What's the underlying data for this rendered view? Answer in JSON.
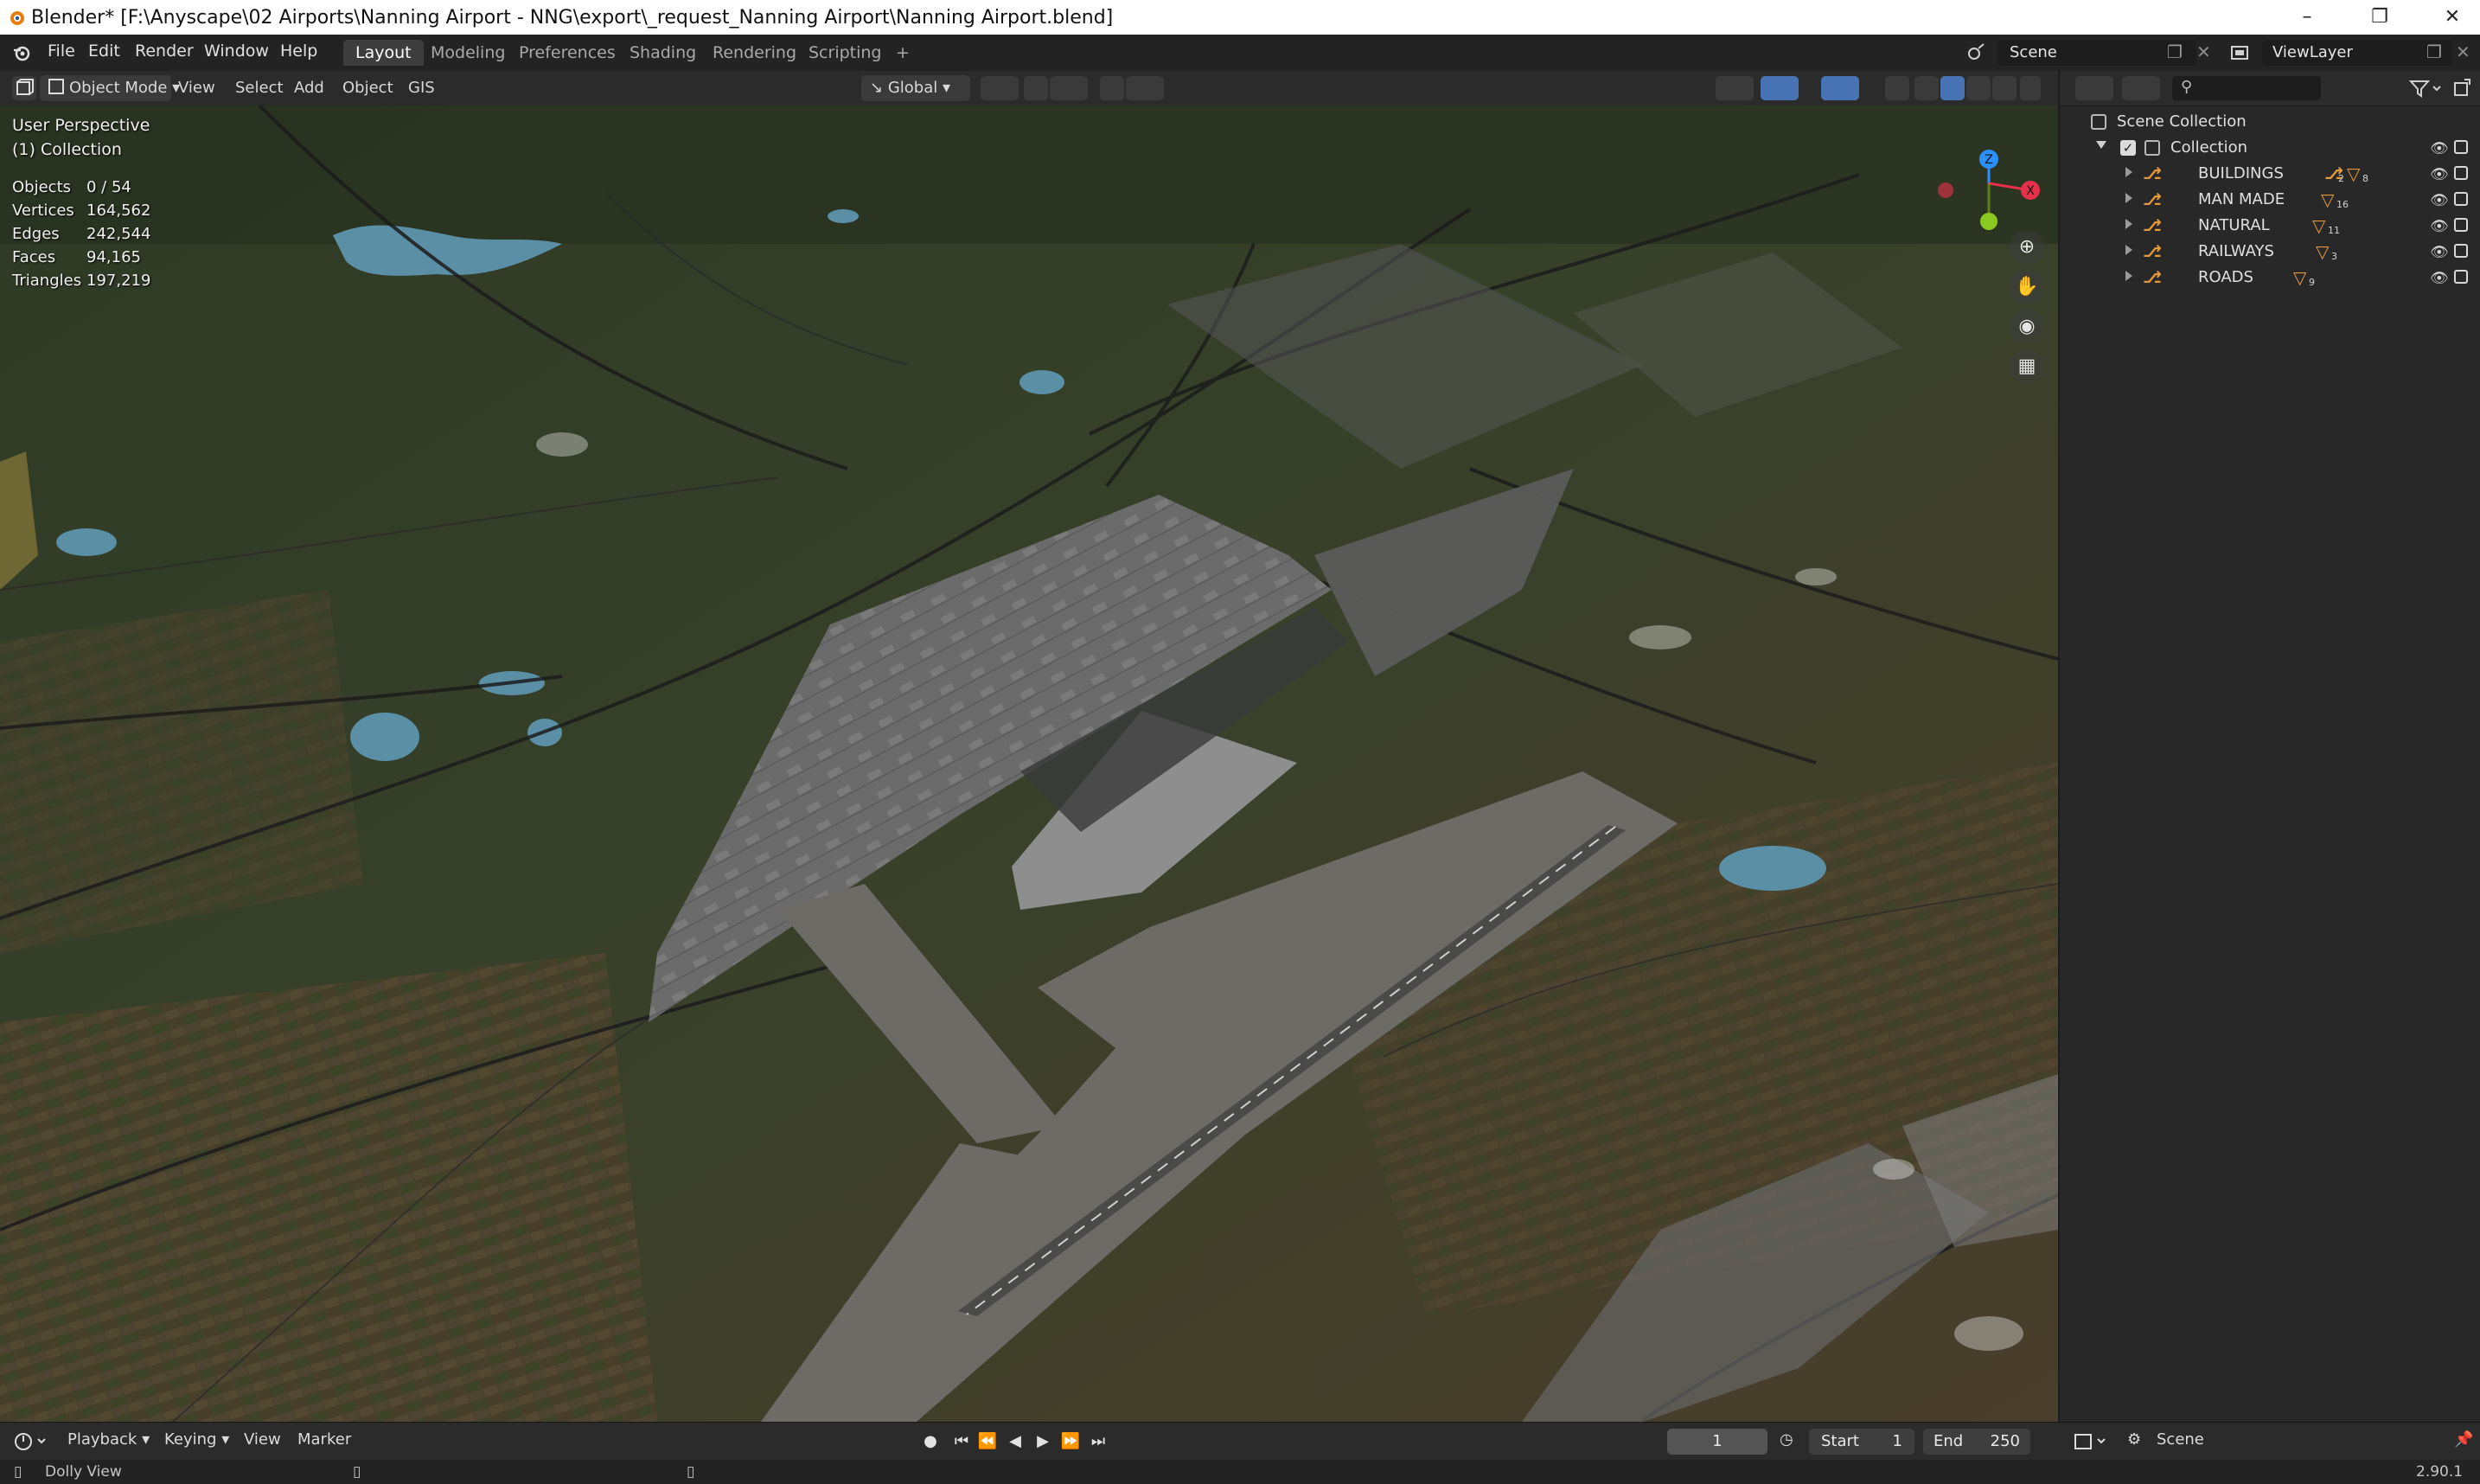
{
  "window": {
    "title": "Blender* [F:\\Anyscape\\02    Airports\\Nanning Airport - NNG\\export\\_request_Nanning Airport\\Nanning Airport.blend]",
    "controls": [
      "minimize",
      "maximize",
      "close"
    ]
  },
  "menu": {
    "items": [
      "File",
      "Edit",
      "Render",
      "Window",
      "Help"
    ],
    "workspaces": [
      "Layout",
      "Modeling",
      "Preferences",
      "Shading",
      "Rendering",
      "Scripting"
    ],
    "active_workspace": "Layout",
    "add_workspace": "+",
    "scene_label": "Scene",
    "view_layer_label": "ViewLayer"
  },
  "viewport_header": {
    "mode": "Object Mode",
    "menus": [
      "View",
      "Select",
      "Add",
      "Object",
      "GIS"
    ],
    "transform_orientation": "Global"
  },
  "viewport": {
    "perspective": "User Perspective",
    "collection": "(1) Collection",
    "stats": [
      {
        "label": "Objects",
        "value": "0 / 54"
      },
      {
        "label": "Vertices",
        "value": "164,562"
      },
      {
        "label": "Edges",
        "value": "242,544"
      },
      {
        "label": "Faces",
        "value": "94,165"
      },
      {
        "label": "Triangles",
        "value": "197,219"
      }
    ],
    "gizmo_axes": {
      "z": "Z",
      "x": "X"
    },
    "colors": {
      "x_axis": "#e7304c",
      "y_axis": "#8ac920",
      "z_axis": "#2c8fff"
    }
  },
  "outliner": {
    "root": "Scene Collection",
    "collection": "Collection",
    "items": [
      {
        "label": "BUILDINGS",
        "sub_empty_count": "2",
        "sub_mesh_count": "8"
      },
      {
        "label": "MAN MADE",
        "sub_mesh_count": "16"
      },
      {
        "label": "NATURAL",
        "sub_mesh_count": "11"
      },
      {
        "label": "RAILWAYS",
        "sub_mesh_count": "3"
      },
      {
        "label": "ROADS",
        "sub_mesh_count": "9"
      }
    ]
  },
  "timeline": {
    "menus": [
      "Playback",
      "Keying",
      "View",
      "Marker"
    ],
    "current_frame": "1",
    "start_label": "Start",
    "start": "1",
    "end_label": "End",
    "end": "250",
    "scene_label": "Scene"
  },
  "statusbar": {
    "left": "Dolly View",
    "version": "2.90.1"
  }
}
